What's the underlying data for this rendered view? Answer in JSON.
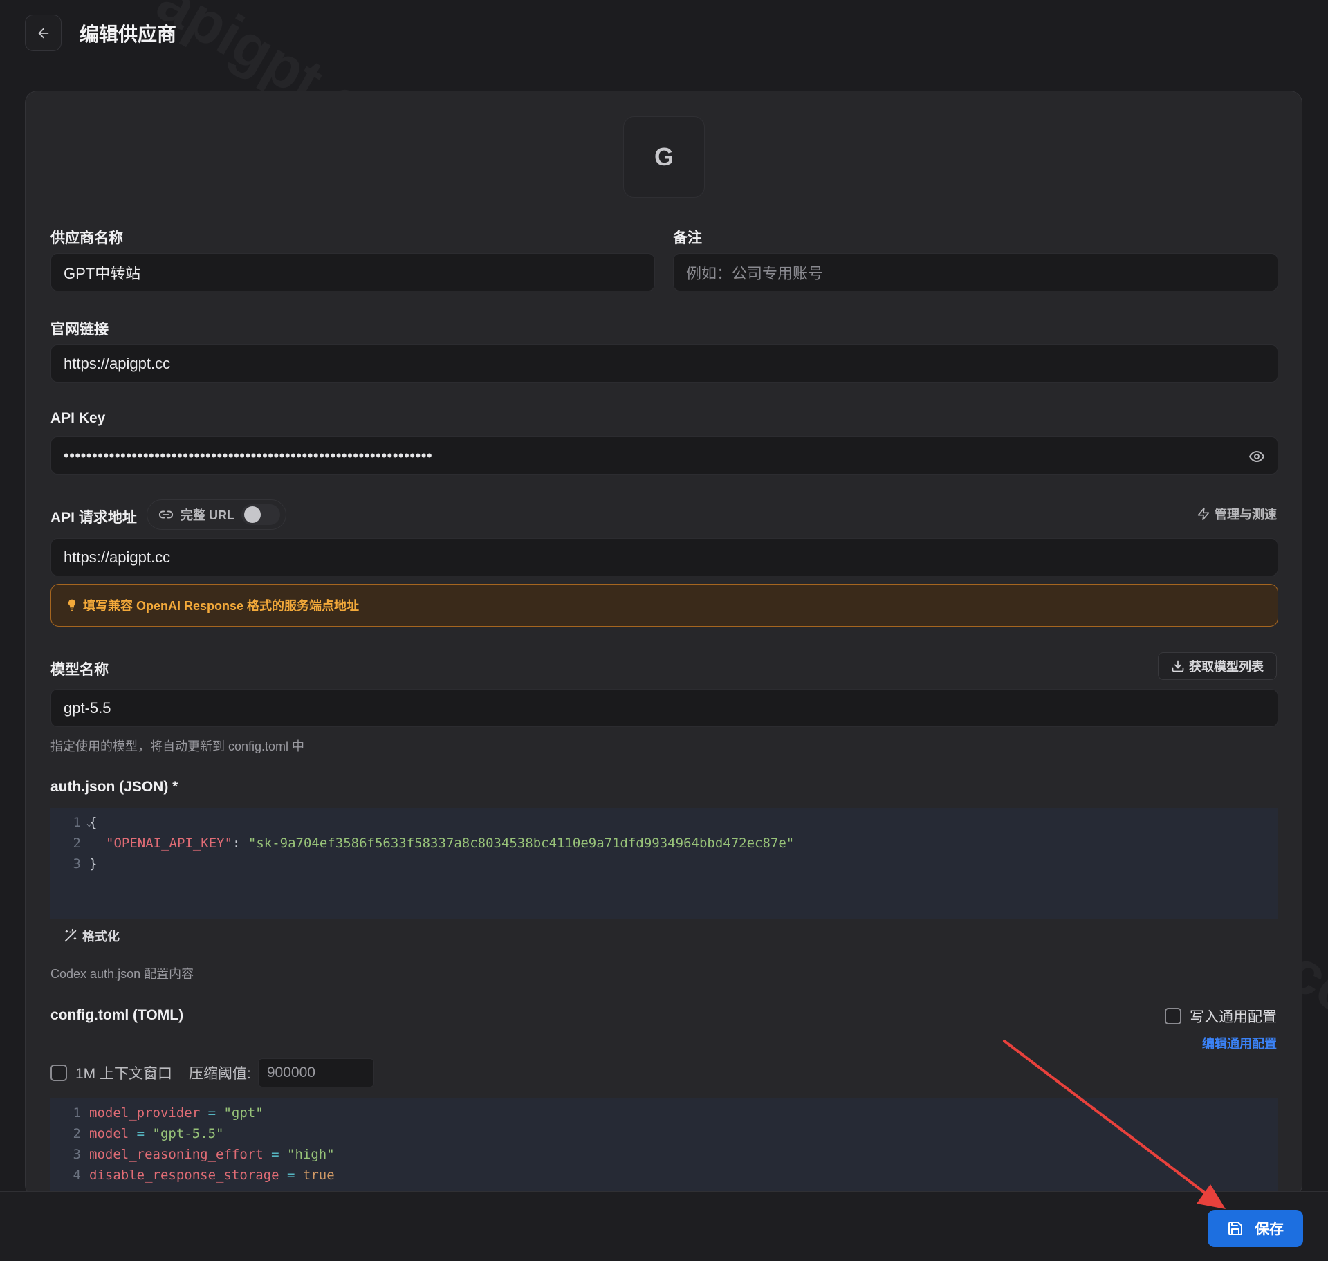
{
  "header": {
    "title": "编辑供应商"
  },
  "avatar": {
    "letter": "G"
  },
  "fields": {
    "provider_name": {
      "label": "供应商名称",
      "value": "GPT中转站"
    },
    "note": {
      "label": "备注",
      "placeholder": "例如：公司专用账号"
    },
    "website": {
      "label": "官网链接",
      "value": "https://apigpt.cc"
    },
    "api_key": {
      "label": "API Key",
      "masked_value": "•••••••••••••••••••••••••••••••••••••••••••••••••••••••••••••••••"
    },
    "endpoint": {
      "label": "API 请求地址",
      "full_url_toggle_label": "完整 URL",
      "full_url_enabled": false,
      "manage_label": "管理与测速",
      "value": "https://apigpt.cc",
      "hint": "填写兼容 OpenAI Response 格式的服务端点地址"
    },
    "model": {
      "label": "模型名称",
      "fetch_button": "获取模型列表",
      "value": "gpt-5.5",
      "help": "指定使用的模型，将自动更新到 config.toml 中"
    }
  },
  "auth_json": {
    "label": "auth.json (JSON) *",
    "line_numbers": [
      "1",
      "2",
      "3"
    ],
    "open_brace": "{",
    "key": "\"OPENAI_API_KEY\"",
    "colon": ": ",
    "value": "\"sk-9a704ef3586f5633f58337a8c8034538bc4110e9a71dfd9934964bbd472ec87e\"",
    "close_brace": "}",
    "format_button": "格式化",
    "help": "Codex auth.json 配置内容"
  },
  "config_toml": {
    "label": "config.toml (TOML)",
    "write_common_label": "写入通用配置",
    "write_common_checked": false,
    "edit_common_link": "编辑通用配置",
    "context_window_label": "1M 上下文窗口",
    "context_window_checked": false,
    "threshold_label": "压缩阈值:",
    "threshold_placeholder": "900000",
    "lines": [
      {
        "n": "1",
        "key": "model_provider",
        "op": " = ",
        "val": "\"gpt\"",
        "type": "str"
      },
      {
        "n": "2",
        "key": "model",
        "op": " = ",
        "val": "\"gpt-5.5\"",
        "type": "str"
      },
      {
        "n": "3",
        "key": "model_reasoning_effort",
        "op": " = ",
        "val": "\"high\"",
        "type": "str"
      },
      {
        "n": "4",
        "key": "disable_response_storage",
        "op": " = ",
        "val": "true",
        "type": "bool"
      }
    ]
  },
  "footer": {
    "save_label": "保存"
  },
  "watermark_text": "apigpt.cc",
  "colors": {
    "accent": "#1d6fe0",
    "hint_text": "#f3a93a",
    "hint_border": "#a5651f",
    "arrow": "#e8413c"
  }
}
